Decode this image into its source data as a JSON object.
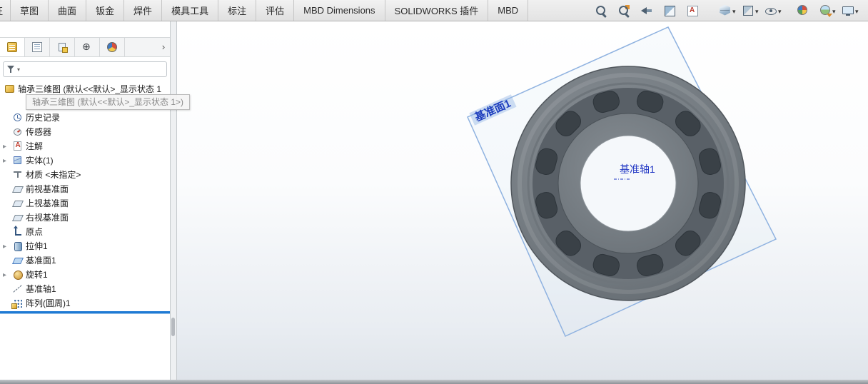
{
  "ribbon": {
    "partial_tab_label": "征",
    "tabs": [
      "草图",
      "曲面",
      "钣金",
      "焊件",
      "模具工具",
      "标注",
      "评估",
      "MBD Dimensions",
      "SOLIDWORKS 插件",
      "MBD"
    ],
    "headsup_icons": [
      {
        "name": "zoom-to-fit-icon",
        "dropdown": false
      },
      {
        "name": "zoom-to-area-icon",
        "dropdown": false
      },
      {
        "name": "previous-view-icon",
        "dropdown": false
      },
      {
        "name": "section-view-icon",
        "dropdown": false
      },
      {
        "name": "dynamic-annotation-icon",
        "dropdown": false
      },
      {
        "name": "view-orientation-icon",
        "dropdown": true
      },
      {
        "name": "display-style-icon",
        "dropdown": true
      },
      {
        "name": "hide-show-items-icon",
        "dropdown": true
      },
      {
        "name": "edit-appearance-icon",
        "dropdown": false
      },
      {
        "name": "apply-scene-icon",
        "dropdown": true
      },
      {
        "name": "view-settings-icon",
        "dropdown": true
      }
    ]
  },
  "panel": {
    "tabs": [
      {
        "icon": "featuremanager-icon",
        "state": "active"
      },
      {
        "icon": "propertymanager-icon"
      },
      {
        "icon": "configurationmanager-icon"
      },
      {
        "icon": "dimxpertmanager-icon"
      },
      {
        "icon": "displaymanager-icon"
      }
    ],
    "overflow_chevron": "›",
    "filter": {
      "value": "",
      "placeholder": ""
    },
    "tree": {
      "root_label": "轴承三维图 (默认<<默认>_显示状态 1",
      "tooltip": "轴承三维图 (默认<<默认>_显示状态 1>)",
      "items": [
        {
          "label": "历史记录",
          "icon": "history-icon",
          "expand": false
        },
        {
          "label": "传感器",
          "icon": "sensor-icon",
          "expand": false
        },
        {
          "label": "注解",
          "icon": "annotations-icon",
          "expand": true
        },
        {
          "label": "实体(1)",
          "icon": "solid-bodies-icon",
          "expand": true
        },
        {
          "label": "材质 <未指定>",
          "icon": "material-icon",
          "expand": false
        },
        {
          "label": "前视基准面",
          "icon": "plane-icon",
          "expand": false
        },
        {
          "label": "上视基准面",
          "icon": "plane-icon",
          "expand": false
        },
        {
          "label": "右视基准面",
          "icon": "plane-icon",
          "expand": false
        },
        {
          "label": "原点",
          "icon": "origin-icon",
          "expand": false
        },
        {
          "label": "拉伸1",
          "icon": "extrude-icon",
          "expand": true
        },
        {
          "label": "基准面1",
          "icon": "plane-blue-icon",
          "expand": false
        },
        {
          "label": "旋转1",
          "icon": "revolve-icon",
          "expand": true
        },
        {
          "label": "基准轴1",
          "icon": "axis-icon",
          "expand": false
        },
        {
          "label": "阵列(圆周)1",
          "icon": "pattern-icon",
          "expand": false
        }
      ]
    }
  },
  "viewport": {
    "plane_label": "基准面1",
    "axis_label": "基准轴1",
    "colors": {
      "label_blue": "#2137c4",
      "plane_edge": "#8fb2e0",
      "bearing_gray": "#767d83",
      "rollback_blue": "#1f7ad4"
    }
  }
}
